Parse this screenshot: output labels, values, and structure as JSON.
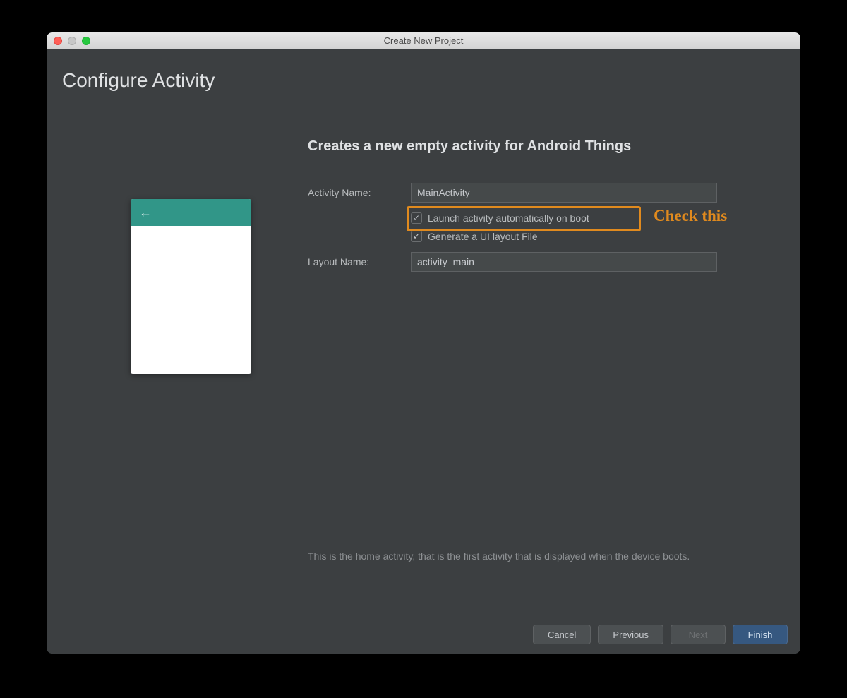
{
  "window": {
    "title": "Create New Project"
  },
  "page": {
    "title": "Configure Activity"
  },
  "form": {
    "heading": "Creates a new empty activity for Android Things",
    "activity_name_label": "Activity Name:",
    "activity_name_value": "MainActivity",
    "launch_on_boot_label": "Launch activity automatically on boot",
    "launch_on_boot_checked": true,
    "generate_layout_label": "Generate a UI layout File",
    "generate_layout_checked": true,
    "layout_name_label": "Layout Name:",
    "layout_name_value": "activity_main",
    "help_text": "This is the home activity, that is the first activity that is displayed when the device boots."
  },
  "annotation": {
    "text": "Check this",
    "color": "#e08a1e"
  },
  "footer": {
    "cancel": "Cancel",
    "previous": "Previous",
    "next": "Next",
    "finish": "Finish"
  }
}
